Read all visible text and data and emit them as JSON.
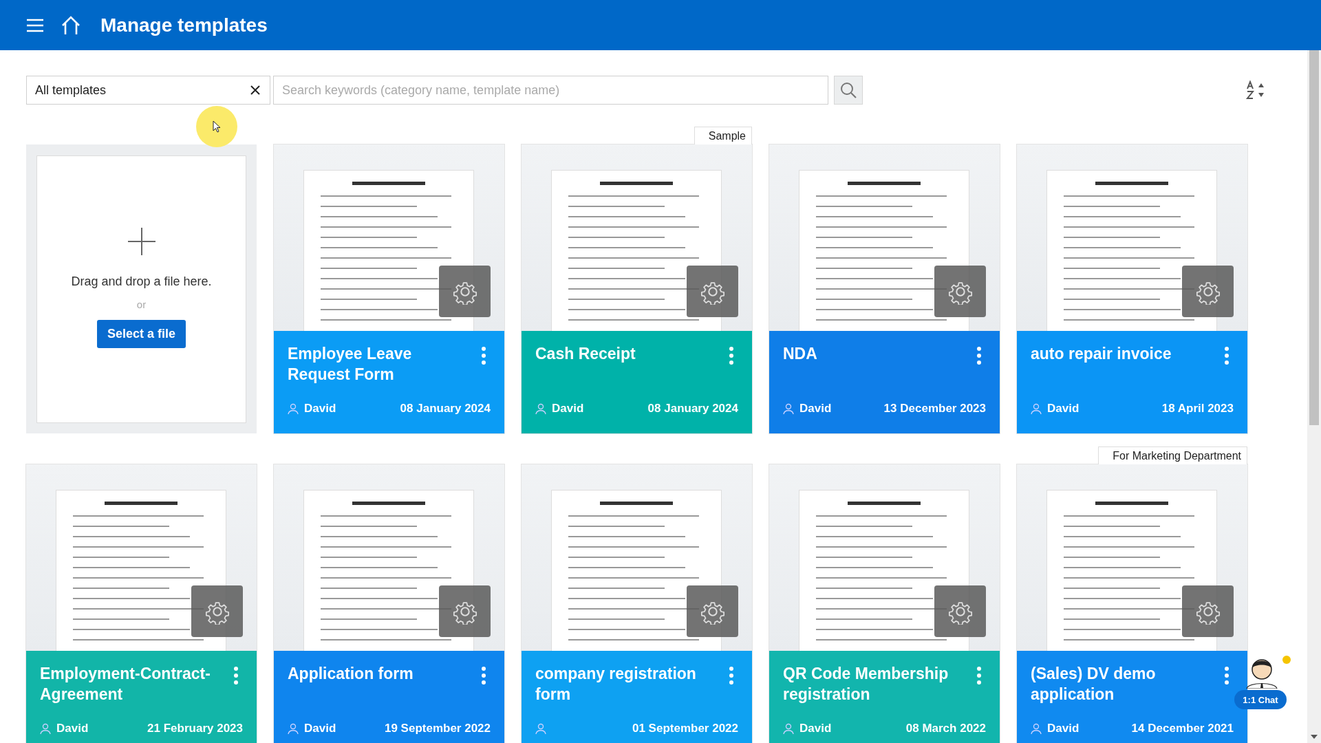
{
  "header": {
    "title": "Manage templates"
  },
  "filter": {
    "category": "All templates",
    "placeholder": "Search keywords (category name, template name)"
  },
  "upload": {
    "prompt": "Drag and drop a file here.",
    "separator": "or",
    "button": "Select a file"
  },
  "templates": [
    {
      "title": "Employee Leave Request Form",
      "author": "David",
      "date": "08 January 2024",
      "color": "#0b9cf5"
    },
    {
      "title": "Cash Receipt",
      "author": "David",
      "date": "08 January 2024",
      "color": "#00b2a9",
      "tag": "Sample"
    },
    {
      "title": "NDA",
      "author": "David",
      "date": "13 December 2023",
      "color": "#0f7ee8"
    },
    {
      "title": "auto repair invoice",
      "author": "David",
      "date": "18 April 2023",
      "color": "#0b95f5"
    },
    {
      "title": "Employment-Contract-Agreement",
      "author": "David",
      "date": "21 February 2023",
      "color": "#12b5a8"
    },
    {
      "title": "Application form",
      "author": "David",
      "date": "19 September 2022",
      "color": "#0f85ee"
    },
    {
      "title": "company registration form",
      "date": "01 September 2022",
      "color": "#0ea1f2"
    },
    {
      "title": "QR Code Membership registration",
      "author": "David",
      "date": "08 March 2022",
      "color": "#12b5ad"
    },
    {
      "title": "(Sales) DV demo application",
      "author": "David",
      "date": "14 December 2021",
      "color": "#108af0",
      "tag": "For Marketing Department"
    }
  ],
  "chat": {
    "label": "1:1 Chat"
  }
}
